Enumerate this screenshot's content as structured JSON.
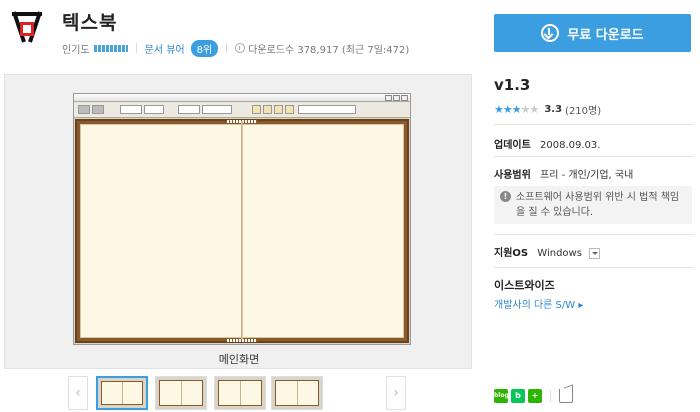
{
  "header": {
    "title": "텍스북",
    "popularity_label": "인기도",
    "category_link": "문서 뷰어",
    "rank": "8위",
    "downloads": "다운로드수 378,917 (최근 7일:472)"
  },
  "download_button": {
    "label": "무료 다운로드"
  },
  "preview": {
    "caption": "메인화면",
    "prev_arrow": "‹",
    "next_arrow": "›",
    "thumbnail_count": 4,
    "active_thumbnail": 1
  },
  "info": {
    "version": "v1.3",
    "stars": "★★★",
    "stars_empty": "★★",
    "rating_score": "3.3",
    "rating_count": "(210명)",
    "update_label": "업데이트",
    "update_value": "2008.09.03.",
    "license_label": "사용범위",
    "license_value": "프리 - 개인/기업, 국내",
    "warning_icon": "!",
    "warning_text": "소프트웨어 사용범위 위반 시 법적 책임을 질 수 있습니다.",
    "os_label": "지원OS",
    "os_value": "Windows",
    "developer": "이스트와이즈",
    "developer_link": "개발사의 다른 S/W ▸"
  },
  "share": {
    "icons": [
      "blog",
      "band",
      "plus"
    ],
    "blog_label": "blog",
    "band_label": "b",
    "plus_label": "+"
  },
  "colors": {
    "accent": "#3a9ee0",
    "book_frame": "#8b5a2b",
    "page": "#fdf8e6",
    "blog": "#2db400",
    "band": "#06c755"
  }
}
